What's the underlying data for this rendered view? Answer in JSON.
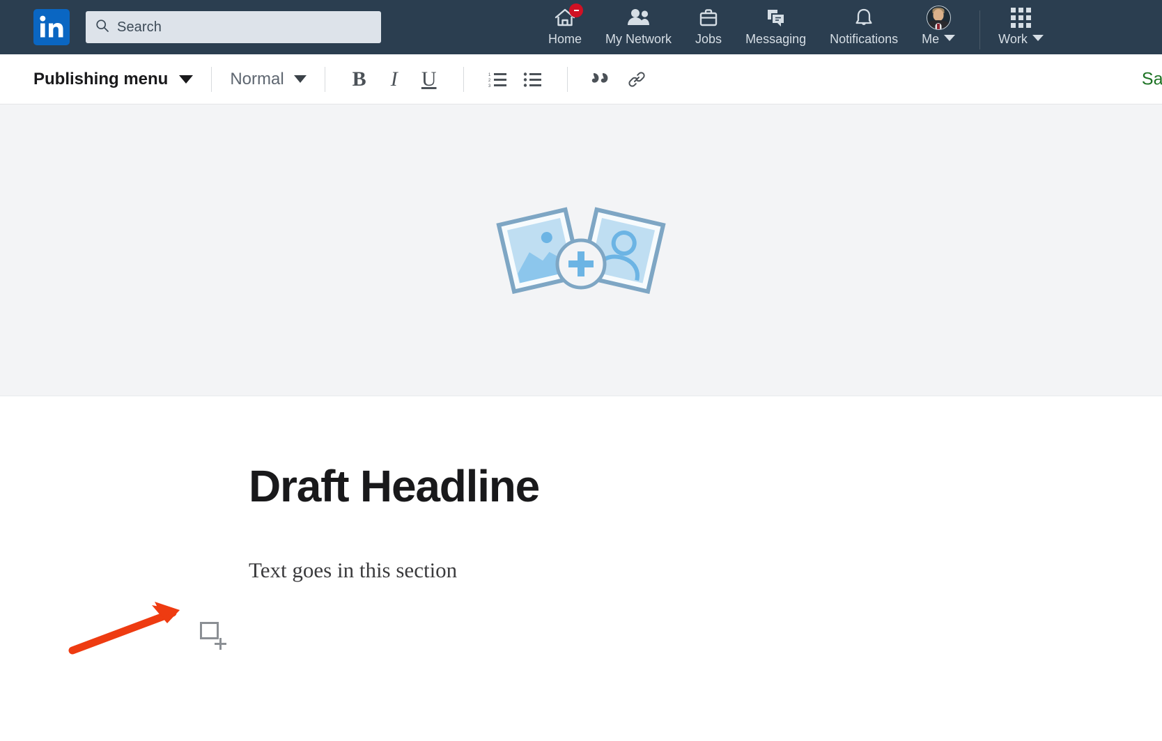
{
  "globalnav": {
    "logo": {
      "icon": "linkedin-logo",
      "text": "in",
      "color": "#0a66c2"
    },
    "search": {
      "icon": "search-icon",
      "placeholder": "Search",
      "value": ""
    },
    "items": [
      {
        "label": "Home",
        "icon": "home-icon",
        "badge": true
      },
      {
        "label": "My Network",
        "icon": "people-icon",
        "badge": false
      },
      {
        "label": "Jobs",
        "icon": "briefcase-icon",
        "badge": false
      },
      {
        "label": "Messaging",
        "icon": "message-icon",
        "badge": false
      },
      {
        "label": "Notifications",
        "icon": "bell-icon",
        "badge": false
      }
    ],
    "me": {
      "label": "Me",
      "icon": "avatar",
      "caret": "chevron-down-icon"
    },
    "work": {
      "label": "Work",
      "icon": "app-grid-icon",
      "caret": "chevron-down-icon"
    },
    "background_color": "#2b3e50"
  },
  "toolbar": {
    "publishing_menu": "Publishing menu",
    "text_style": "Normal",
    "style_options": [
      "Normal"
    ],
    "buttons": [
      {
        "name": "bold",
        "glyph": "B"
      },
      {
        "name": "italic",
        "glyph": "I"
      },
      {
        "name": "underline",
        "glyph": "U"
      }
    ],
    "list_buttons": [
      {
        "name": "ordered-list",
        "glyph": "ordered-list-icon"
      },
      {
        "name": "unordered-list",
        "glyph": "bulleted-list-icon"
      }
    ],
    "insert_buttons": [
      {
        "name": "quote",
        "glyph": "quote-icon"
      },
      {
        "name": "link",
        "glyph": "link-icon"
      }
    ],
    "save_label": "Sav",
    "save_color": "#1d7324"
  },
  "cover": {
    "name": "cover-image-placeholder",
    "icon": "add-photos-icon",
    "background_color": "#f3f4f6",
    "accent_color": "#7ea6c4",
    "fill_color": "#bfdef2"
  },
  "article": {
    "headline": "Draft Headline",
    "body": "Text goes in this section",
    "add_block_icon": "add-content-icon"
  },
  "annotation": {
    "arrow": {
      "name": "red-arrow-annotation",
      "color": "#ee3b11"
    }
  }
}
